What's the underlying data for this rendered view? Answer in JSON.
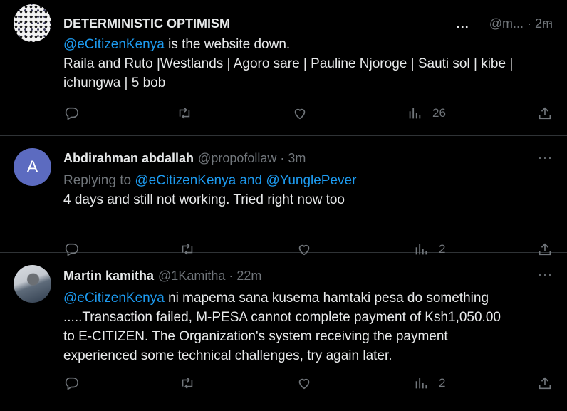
{
  "tweets": [
    {
      "name": "DETERMINISTIC OPTIMISM",
      "badge": "...",
      "handle": "@m...",
      "time": "2m",
      "mention": "@eCitizenKenya",
      "text_after_mention": " is the website down.",
      "line2": "Raila and Ruto |Westlands | Agoro sare | Pauline Njoroge | Sauti sol | kibe |",
      "line3": "ichungwa | 5 bob",
      "views": "26",
      "more": "···"
    },
    {
      "avatar_letter": "A",
      "name": "Abdirahman abdallah",
      "handle": "@propofollaw",
      "time": "3m",
      "replying_prefix": "Replying to ",
      "replying_to": "@eCitizenKenya and @YunglePever",
      "text": "4 days and still not working. Tried right now too",
      "views": "2",
      "more": "···"
    },
    {
      "name": "Martin kamitha",
      "handle": "@1Kamitha",
      "time": "22m",
      "mention": "@eCitizenKenya",
      "text_after_mention": " ni mapema sana kusema hamtaki pesa do something",
      "line2": ".....Transaction failed, M-PESA cannot complete payment of Ksh1,050.00",
      "line3": "to E-CITIZEN. The Organization's system receiving the payment",
      "line4": "experienced some technical challenges, try again later.",
      "views": "2",
      "more": "···"
    }
  ],
  "separator": "·",
  "icons": [
    "reply-icon",
    "retweet-icon",
    "like-icon",
    "views-icon",
    "share-icon",
    "more-icon"
  ]
}
